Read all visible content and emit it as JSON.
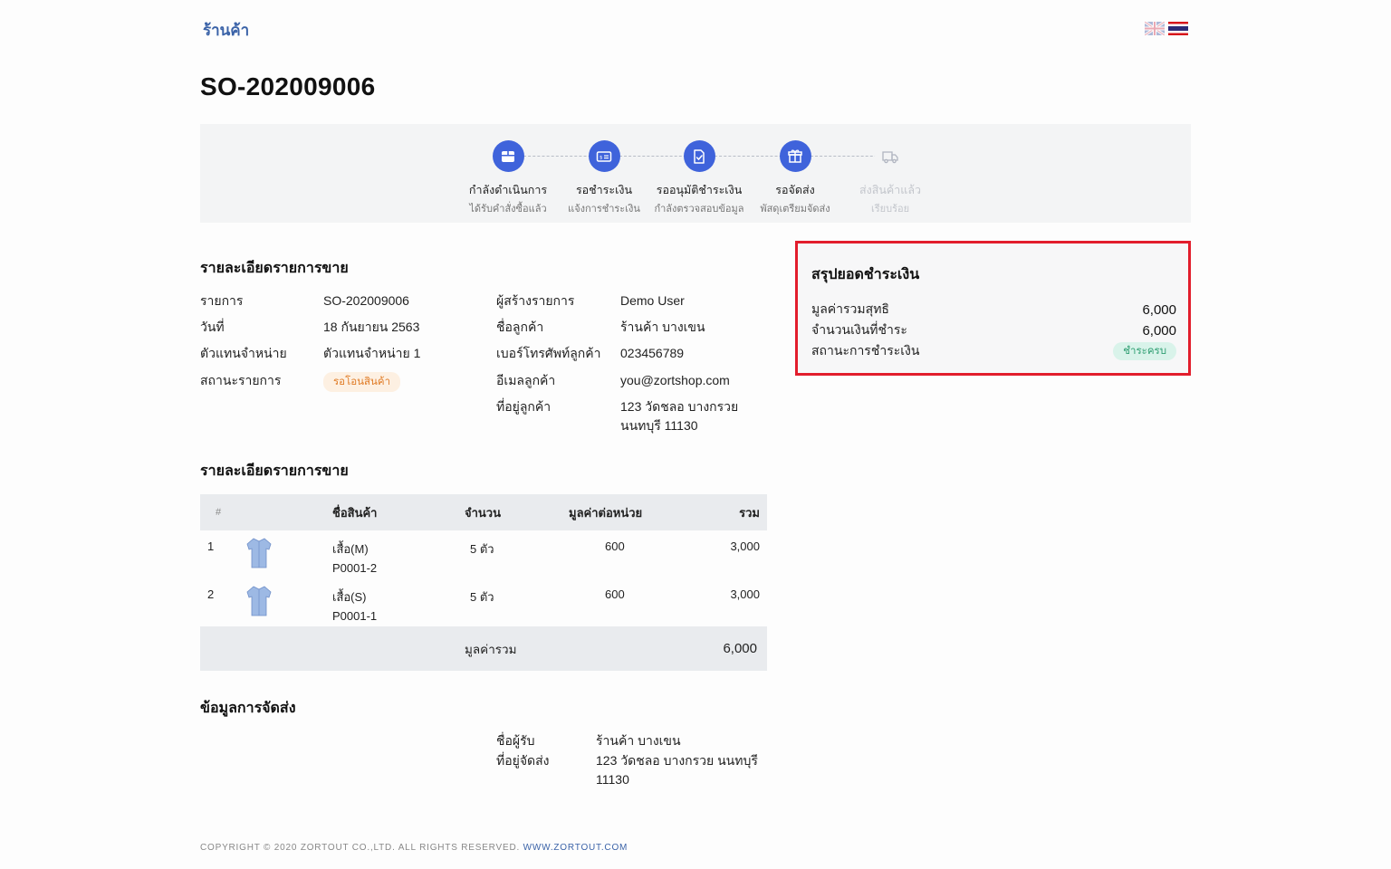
{
  "header": {
    "shop_name": "ร้านค้า",
    "languages": [
      "en-flag-icon",
      "th-flag-icon"
    ]
  },
  "order": {
    "number": "SO-202009006"
  },
  "steps": [
    {
      "title": "กำลังดำเนินการ",
      "subtitle": "ได้รับคำสั่งซื้อแล้ว",
      "icon": "box-icon",
      "active": true
    },
    {
      "title": "รอชำระเงิน",
      "subtitle": "แจ้งการชำระเงิน",
      "icon": "payment-card-icon",
      "active": true
    },
    {
      "title": "รออนุมัติชำระเงิน",
      "subtitle": "กำลังตรวจสอบข้อมูล",
      "icon": "document-check-icon",
      "active": true
    },
    {
      "title": "รอจัดส่ง",
      "subtitle": "พัสดุเตรียมจัดส่ง",
      "icon": "package-icon",
      "active": true
    },
    {
      "title": "ส่งสินค้าแล้ว",
      "subtitle": "เรียบร้อย",
      "icon": "truck-icon",
      "active": false
    }
  ],
  "details": {
    "title": "รายละเอียดรายการขาย",
    "left": [
      {
        "label": "รายการ",
        "value": "SO-202009006"
      },
      {
        "label": "วันที่",
        "value": "18 กันยายน 2563"
      },
      {
        "label": "ตัวแทนจำหน่าย",
        "value": "ตัวแทนจำหน่าย 1"
      },
      {
        "label": "สถานะรายการ",
        "value": "รอโอนสินค้า"
      }
    ],
    "right": [
      {
        "label": "ผู้สร้างรายการ",
        "value": "Demo User"
      },
      {
        "label": "ชื่อลูกค้า",
        "value": "ร้านค้า บางเขน"
      },
      {
        "label": "เบอร์โทรศัพท์ลูกค้า",
        "value": "023456789"
      },
      {
        "label": "อีเมลลูกค้า",
        "value": "you@zortshop.com"
      },
      {
        "label": "ที่อยู่ลูกค้า",
        "value_line1": "123 วัดชลอ บางกรวย",
        "value_line2": "นนทบุรี 11130"
      }
    ]
  },
  "items_section": {
    "title": "รายละเอียดรายการขาย",
    "columns": {
      "index": "#",
      "name": "ชื่อสินค้า",
      "qty": "จำนวน",
      "unit_price": "มูลค่าต่อหน่วย",
      "total": "รวม"
    },
    "rows": [
      {
        "index": "1",
        "name": "เสื้อ(M)",
        "sku": "P0001-2",
        "qty": "5 ตัว",
        "unit_price": "600",
        "total": "3,000"
      },
      {
        "index": "2",
        "name": "เสื้อ(S)",
        "sku": "P0001-1",
        "qty": "5 ตัว",
        "unit_price": "600",
        "total": "3,000"
      }
    ],
    "footer_label": "มูลค่ารวม",
    "footer_total": "6,000"
  },
  "shipping": {
    "title": "ข้อมูลการจัดส่ง",
    "recipient_label": "ชื่อผู้รับ",
    "recipient_value": "ร้านค้า บางเขน",
    "address_label": "ที่อยู่จัดส่ง",
    "address_line1": "123 วัดชลอ บางกรวย นนทบุรี",
    "address_line2": "11130"
  },
  "summary": {
    "title": "สรุปยอดชำระเงิน",
    "net_label": "มูลค่ารวมสุทธิ",
    "net_value": "6,000",
    "paid_label": "จำนวนเงินที่ชำระ",
    "paid_value": "6,000",
    "status_label": "สถานะการชำระเงิน",
    "status_value": "ชำระครบ"
  },
  "footer": {
    "copyright": "COPYRIGHT © 2020 ZORTOUT CO.,LTD. ALL RIGHTS RESERVED.",
    "link": "WWW.ZORTOUT.COM"
  },
  "colors": {
    "accent": "#3f63db",
    "link": "#3b63a8",
    "highlight_border": "#e21d2c",
    "pending_status": "#e07c27",
    "paid_status": "#2f9e72"
  }
}
